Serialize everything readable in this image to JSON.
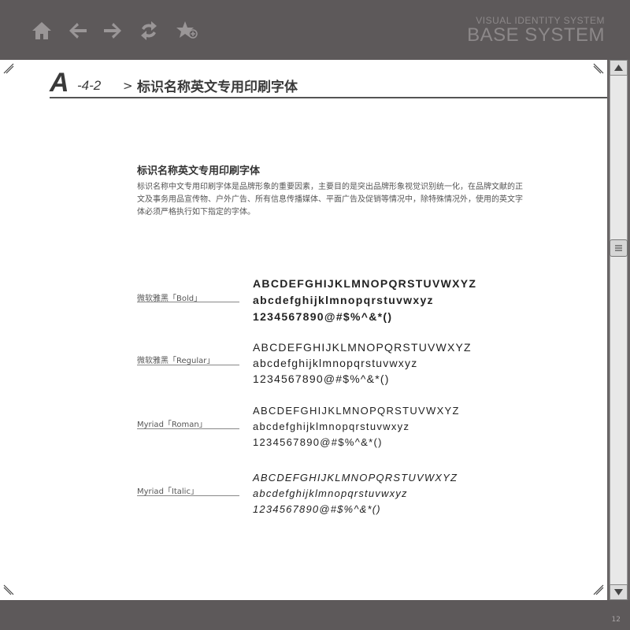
{
  "brand": {
    "subtitle": "VISUAL IDENTITY SYSTEM",
    "title": "BASE SYSTEM"
  },
  "toolbar": {
    "icons": [
      "home-icon",
      "back-arrow-icon",
      "forward-arrow-icon",
      "refresh-icon",
      "favorite-add-icon"
    ]
  },
  "section": {
    "letter": "A",
    "number": "-4-2",
    "arrow": ">",
    "title": "标识名称英文专用印刷字体"
  },
  "content": {
    "title": "标识名称英文专用印刷字体",
    "body": "标识名称中文专用印刷字体是品牌形象的重要因素，主要目的是突出品牌形象视觉识别统一化，在品牌文献的正文及事务用品宣传物、户外广告、所有信息传播媒体、平面广告及促销等情况中，除特殊情况外，使用的英文字体必须严格执行如下指定的字体。"
  },
  "fonts": [
    {
      "label": "微软雅黑「Bold」",
      "lines": [
        "ABCDEFGHIJKLMNOPQRSTUVWXYZ",
        "abcdefghijklmnopqrstuvwxyz",
        "1234567890@#$%^&*()"
      ]
    },
    {
      "label": "微软雅黑「Regular」",
      "lines": [
        "ABCDEFGHIJKLMNOPQRSTUVWXYZ",
        "abcdefghijklmnopqrstuvwxyz",
        "1234567890@#$%^&*()"
      ]
    },
    {
      "label": "Myriad「Roman」",
      "lines": [
        "ABCDEFGHIJKLMNOPQRSTUVWXYZ",
        "abcdefghijklmnopqrstuvwxyz",
        "1234567890@#$%^&*()"
      ]
    },
    {
      "label": "Myriad「Italic」",
      "lines": [
        "ABCDEFGHIJKLMNOPQRSTUVWXYZ",
        "abcdefghijklmnopqrstuvwxyz",
        "1234567890@#$%^&*()"
      ]
    }
  ],
  "footer": {
    "page_number": "12"
  },
  "colors": {
    "chrome": "#5d595a",
    "page": "#ffffff",
    "text": "#333333"
  }
}
